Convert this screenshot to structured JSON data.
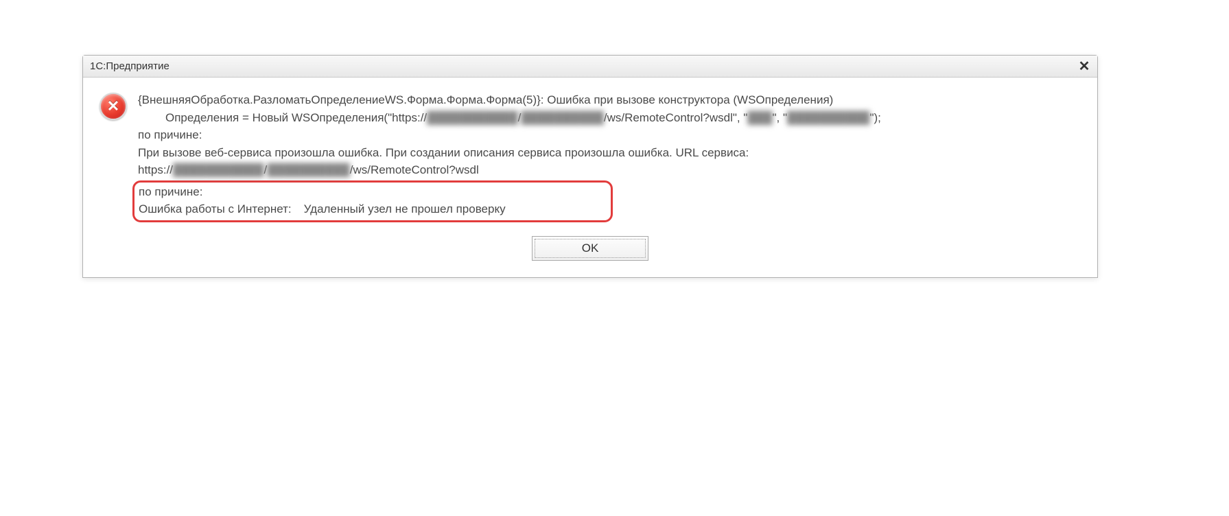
{
  "dialog": {
    "title": "1С:Предприятие",
    "close_label": "✕",
    "message": {
      "line1": "{ВнешняяОбработка.РазломатьОпределениеWS.Форма.Форма.Форма(5)}: Ошибка при вызове конструктора (WSОпределения)",
      "line2_prefix": "Определения = Новый WSОпределения(\"https://",
      "line2_blur1": "███████████",
      "line2_mid1": "/",
      "line2_blur2": "██████████",
      "line2_mid2": "/ws/RemoteControl?wsdl\", \"",
      "line2_blur3": "███",
      "line2_mid3": "\", \"",
      "line2_blur4": "██████████",
      "line2_suffix": "\");",
      "line3": "по причине:",
      "line4": "При вызове веб-сервиса произошла ошибка. При создании описания сервиса произошла ошибка. URL сервиса:",
      "line5_prefix": "https://",
      "line5_blur1": "███████████",
      "line5_mid1": "/",
      "line5_blur2": "██████████",
      "line5_suffix": "/ws/RemoteControl?wsdl",
      "highlight_line1": "по причине:",
      "highlight_line2a": "Ошибка работы с Интернет:",
      "highlight_line2b": "Удаленный узел не прошел проверку"
    },
    "ok_label": "OK"
  }
}
